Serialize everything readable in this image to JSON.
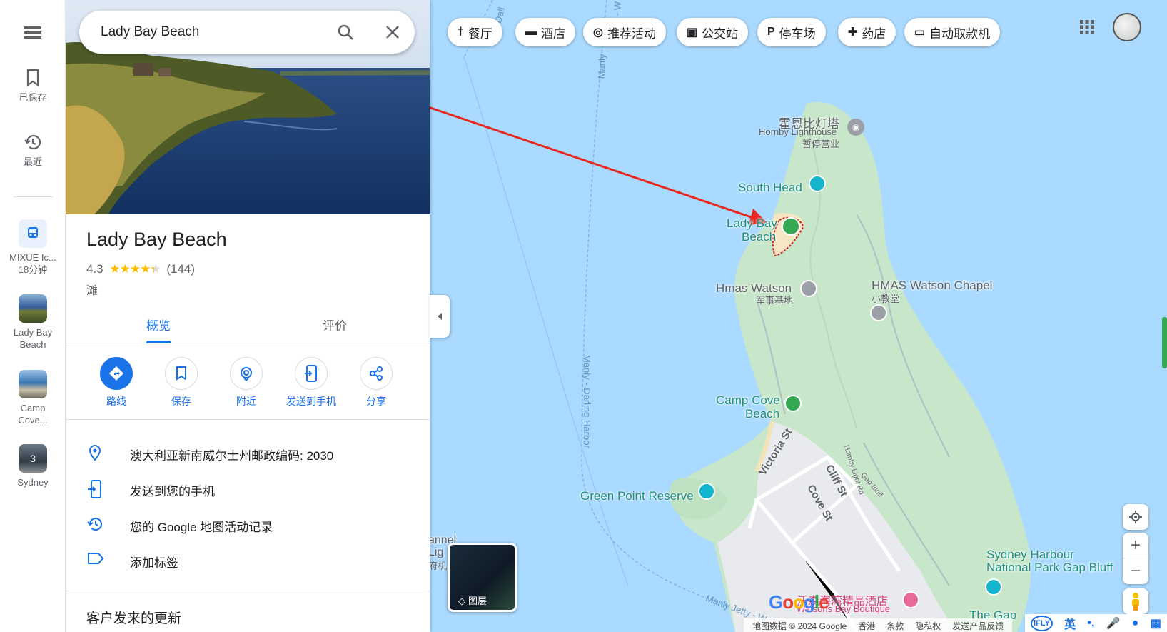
{
  "search": {
    "query": "Lady Bay Beach"
  },
  "rail": {
    "saved": "已保存",
    "recent": "最近",
    "items": [
      {
        "line1": "MIXUE Ic...",
        "line2": "18分钟"
      },
      {
        "line1": "Lady Bay",
        "line2": "Beach"
      },
      {
        "line1": "Camp",
        "line2": "Cove..."
      },
      {
        "line1": "Sydney",
        "line2": "",
        "badge": "3"
      }
    ]
  },
  "place": {
    "title": "Lady Bay Beach",
    "rating": "4.3",
    "stars": 4.3,
    "reviews": "(144)",
    "category": "滩"
  },
  "tabs": [
    "概览",
    "评价"
  ],
  "actions": [
    "路线",
    "保存",
    "附近",
    "发送到手机",
    "分享"
  ],
  "info": [
    {
      "icon": "location-pin-icon",
      "text": "澳大利亚新南威尔士州邮政编码: 2030"
    },
    {
      "icon": "send-to-phone-icon",
      "text": "发送到您的手机"
    },
    {
      "icon": "history-icon",
      "text": "您的 Google 地图活动记录"
    },
    {
      "icon": "label-icon",
      "text": "添加标签"
    }
  ],
  "section_title": "客户发来的更新",
  "chips": [
    {
      "icon": "restaurant-icon",
      "label": "餐厅"
    },
    {
      "icon": "hotel-icon",
      "label": "酒店"
    },
    {
      "icon": "camera-icon",
      "label": "推荐活动"
    },
    {
      "icon": "transit-icon",
      "label": "公交站"
    },
    {
      "icon": "parking-icon",
      "label": "停车场"
    },
    {
      "icon": "pharmacy-icon",
      "label": "药店"
    },
    {
      "icon": "atm-icon",
      "label": "自动取款机"
    }
  ],
  "map_labels": {
    "lighthouse": "霍恩比灯塔",
    "lighthouse_en": "Hornby Lighthouse",
    "lighthouse_status": "暂停营业",
    "south_head": "South Head",
    "lady_bay_1": "Lady Bay",
    "lady_bay_2": "Beach",
    "hmas_watson": "Hmas Watson",
    "hmas_watson_sub": "军事基地",
    "chapel": "HMAS Watson Chapel",
    "chapel_sub": "小教堂",
    "camp_cove_1": "Camp Cove",
    "camp_cove_2": "Beach",
    "green_point": "Green Point Reserve",
    "sydney_harbour_1": "Sydney Harbour",
    "sydney_harbour_2": "National Park Gap Bluff",
    "the_gap": "The Gap",
    "hotel_cn": "沃森海湾精品酒店",
    "hotel_en": "Watsons Bay Boutique",
    "victoria_st": "Victoria St",
    "cliff_st": "Cliff St",
    "cove_st": "Cove St",
    "hornby_rd": "Hornby Light Rd",
    "gap_bluff": "Gap Bluff",
    "manly_darling": "Manly - Darling Harbor",
    "manly_w": "Manly - W",
    "manly_jetty": "Manly Jetty - W",
    "manly_top": "Manly",
    "dall": "Dall",
    "channel": "annel",
    "lig": "Lig",
    "fu": "府机"
  },
  "layers_label": "图层",
  "google": "Google",
  "attribution": [
    "地图数据 © 2024 Google",
    "香港",
    "条款",
    "隐私权",
    "发送产品反馈"
  ],
  "ime": [
    "iFLY",
    "英"
  ],
  "colors": {
    "accent": "#1a73e8",
    "water": "#aadaff",
    "land": "#c8e6c9",
    "arrow": "#e8281e",
    "poi": "#1e8e7e"
  }
}
